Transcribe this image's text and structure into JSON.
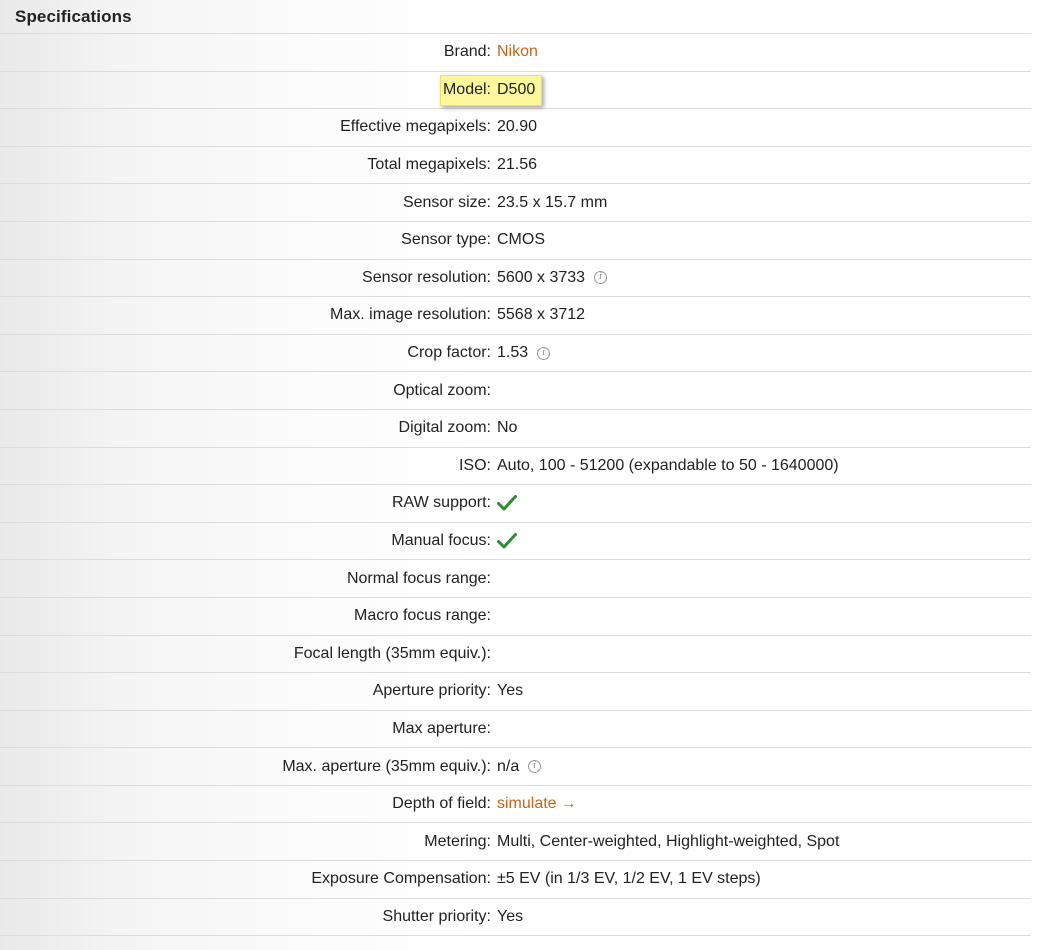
{
  "header": {
    "title": "Specifications"
  },
  "specs": [
    {
      "label": "Brand:",
      "value": "Nikon",
      "link": true
    },
    {
      "label": "Model:",
      "value": "D500",
      "highlight": true
    },
    {
      "label": "Effective megapixels:",
      "value": "20.90"
    },
    {
      "label": "Total megapixels:",
      "value": "21.56"
    },
    {
      "label": "Sensor size:",
      "value": "23.5 x 15.7 mm"
    },
    {
      "label": "Sensor type:",
      "value": "CMOS"
    },
    {
      "label": "Sensor resolution:",
      "value": "5600 x 3733",
      "info": true
    },
    {
      "label": "Max. image resolution:",
      "value": "5568 x 3712"
    },
    {
      "label": "Crop factor:",
      "value": "1.53",
      "info": true
    },
    {
      "label": "Optical zoom:",
      "value": ""
    },
    {
      "label": "Digital zoom:",
      "value": "No"
    },
    {
      "label": "ISO:",
      "value": "Auto, 100 - 51200 (expandable to 50 - 1640000)"
    },
    {
      "label": "RAW support:",
      "value": "",
      "check": true
    },
    {
      "label": "Manual focus:",
      "value": "",
      "check": true
    },
    {
      "label": "Normal focus range:",
      "value": ""
    },
    {
      "label": "Macro focus range:",
      "value": ""
    },
    {
      "label": "Focal length (35mm equiv.):",
      "value": ""
    },
    {
      "label": "Aperture priority:",
      "value": "Yes"
    },
    {
      "label": "Max aperture:",
      "value": ""
    },
    {
      "label": "Max. aperture (35mm equiv.):",
      "value": "n/a",
      "info": true
    },
    {
      "label": "Depth of field:",
      "value": "simulate",
      "link": true,
      "arrow": "→"
    },
    {
      "label": "Metering:",
      "value": "Multi, Center-weighted, Highlight-weighted, Spot"
    },
    {
      "label": "Exposure Compensation:",
      "value": "±5 EV (in 1/3 EV, 1/2 EV, 1 EV steps)"
    },
    {
      "label": "Shutter priority:",
      "value": "Yes"
    }
  ],
  "icons": {
    "info": "info-icon",
    "check": "checkmark-icon",
    "check_color": "#2e8b2e",
    "link_color": "#c8651b",
    "highlight_color": "#fbf79a"
  }
}
